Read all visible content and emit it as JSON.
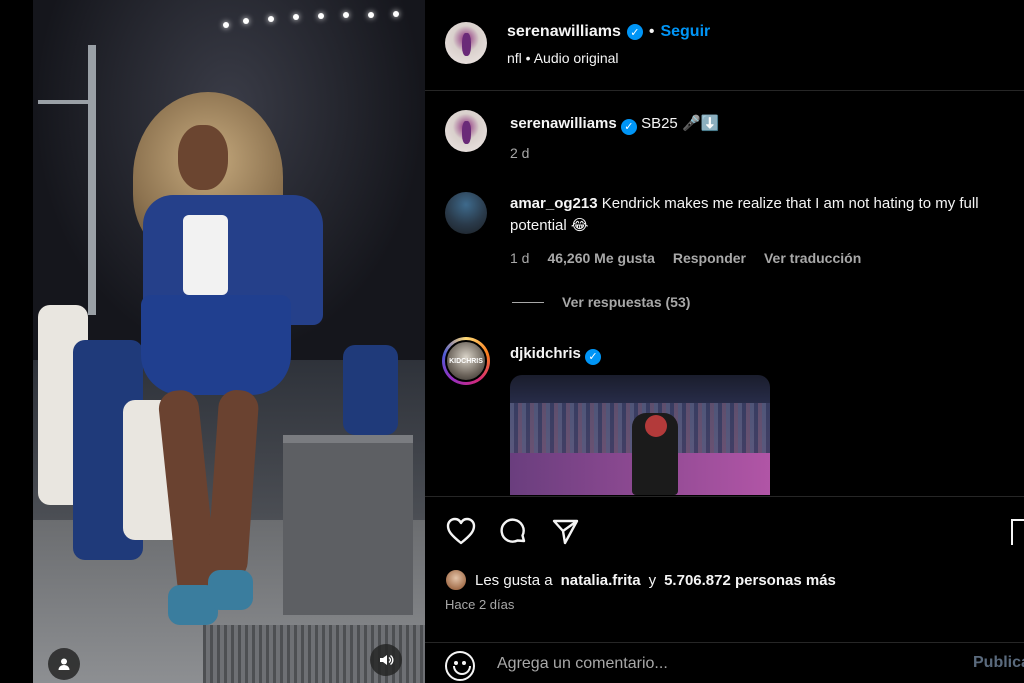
{
  "header": {
    "username": "serenawilliams",
    "separator": "•",
    "follow_label": "Seguir",
    "subtitle": "nfl • Audio original"
  },
  "caption": {
    "username": "serenawilliams",
    "text": "SB25 🎤⬇️",
    "time": "2 d"
  },
  "comments": [
    {
      "username": "amar_og213",
      "text": "Kendrick makes me realize that I am not hating to my full potential 😂",
      "time": "1 d",
      "likes": "46,260 Me gusta",
      "reply_label": "Responder",
      "translate_label": "Ver traducción",
      "replies_label": "Ver respuestas (53)"
    },
    {
      "username": "djkidchris",
      "avatar_text": "KIDCHRIS"
    }
  ],
  "likes": {
    "prefix": "Les gusta a",
    "user": "natalia.frita",
    "connector": "y",
    "count_text": "5.706.872 personas más"
  },
  "posted_ago": "Hace 2 días",
  "add_comment": {
    "placeholder": "Agrega un comentario...",
    "post_label": "Publicar"
  },
  "colors": {
    "accent": "#0095f6",
    "muted": "#a8a8a8",
    "background": "#000000"
  },
  "icons": [
    "user-icon",
    "sound-icon",
    "heart-icon",
    "comment-icon",
    "share-icon",
    "bookmark-icon",
    "emoji-icon",
    "verified-icon"
  ]
}
